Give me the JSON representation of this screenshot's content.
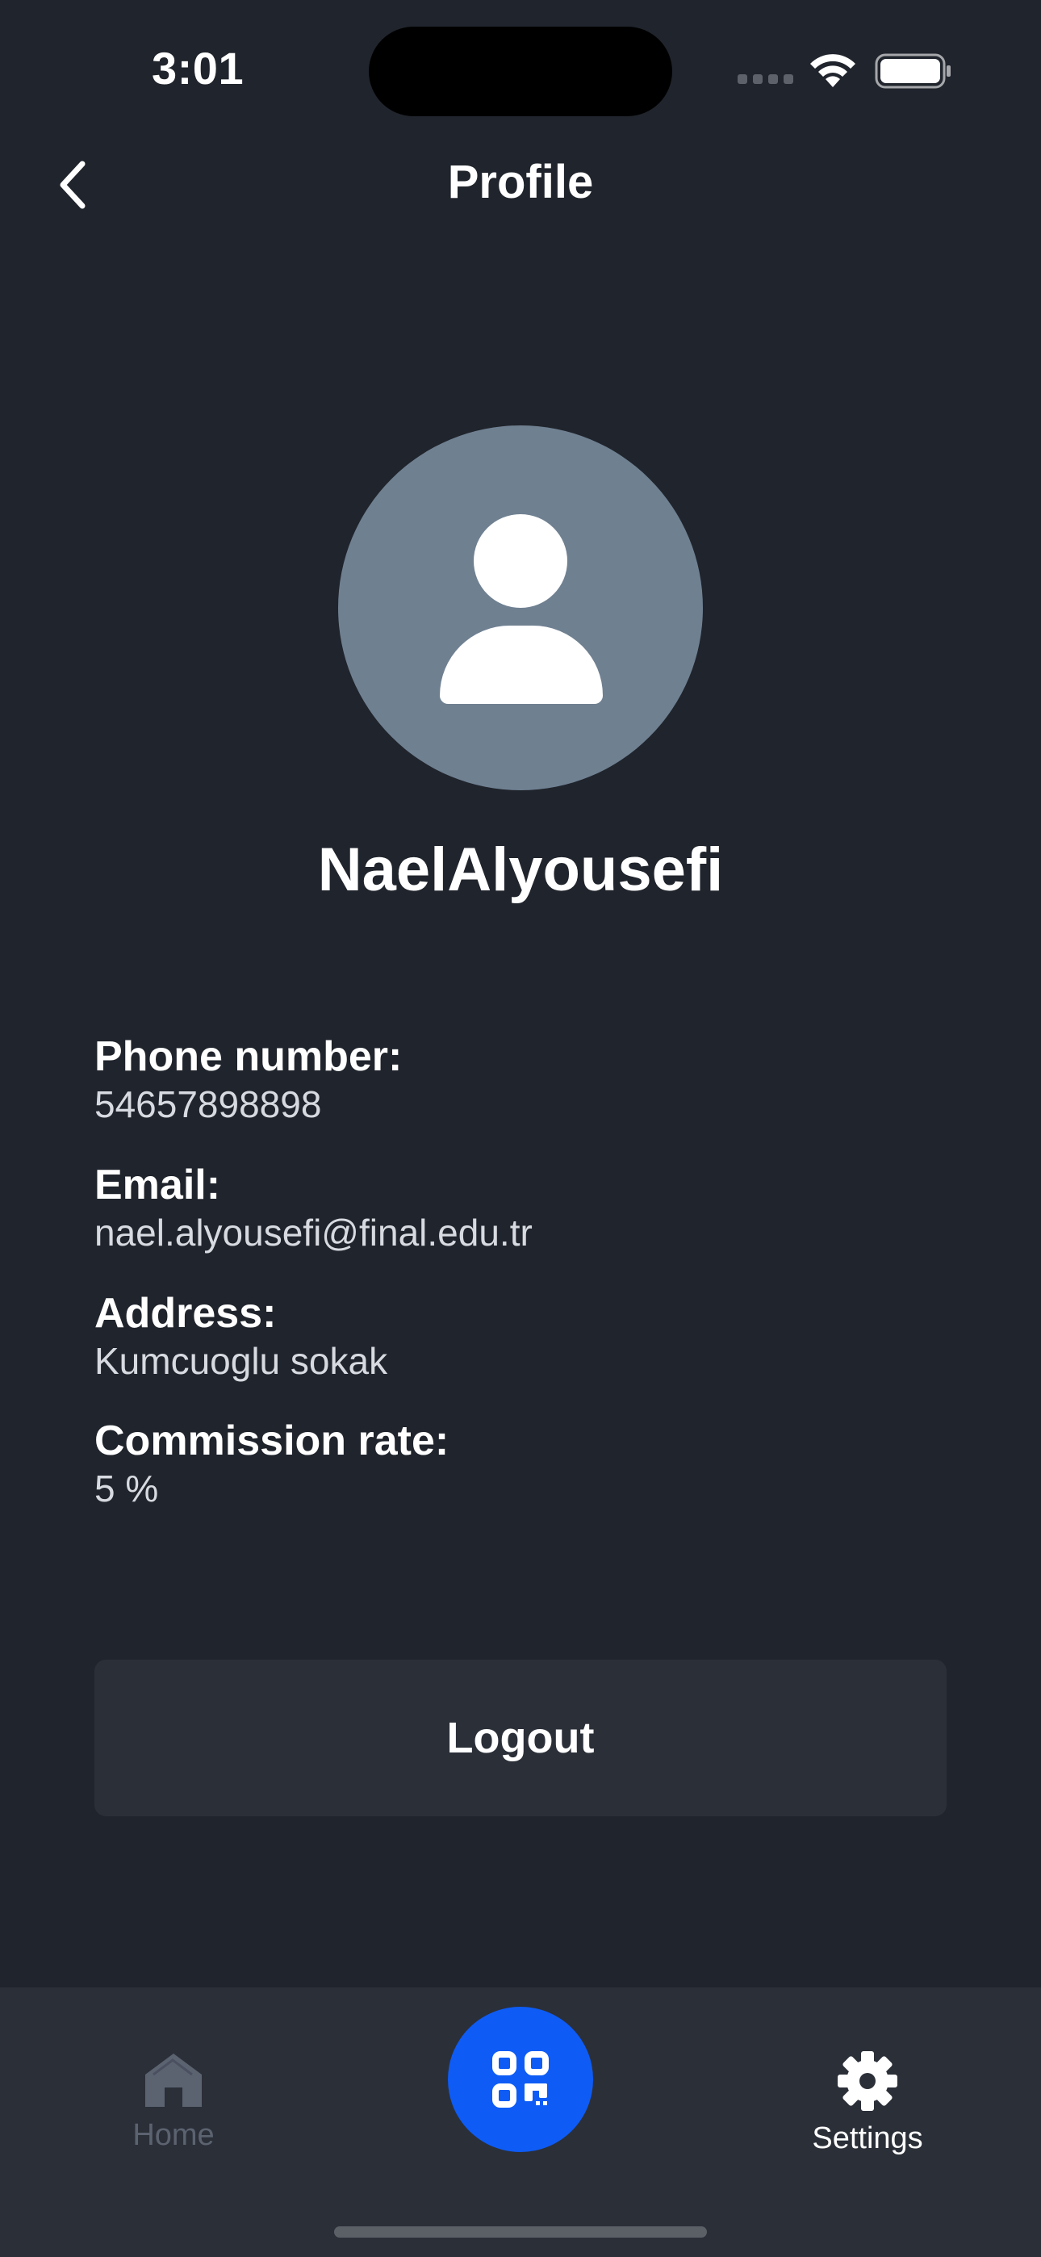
{
  "status_bar": {
    "time": "3:01"
  },
  "header": {
    "title": "Profile"
  },
  "profile": {
    "name": "NaelAlyousefi",
    "fields": [
      {
        "label": "Phone number:",
        "value": "54657898898"
      },
      {
        "label": "Email:",
        "value": "nael.alyousefi@final.edu.tr"
      },
      {
        "label": "Address:",
        "value": "Kumcuoglu sokak"
      },
      {
        "label": "Commission rate:",
        "value": "5 %"
      }
    ]
  },
  "logout_label": "Logout",
  "tab_bar": {
    "home_label": "Home",
    "settings_label": "Settings",
    "active_tab": "Settings"
  },
  "colors": {
    "background": "#20242c",
    "surface": "#2b2f38",
    "accent": "#0e5cf5",
    "avatar": "#6f8091",
    "inactive": "#5c6370"
  },
  "icons": {
    "back": "chevron-left-icon",
    "home": "home-icon",
    "scan": "qr-code-icon",
    "settings": "gear-icon"
  }
}
